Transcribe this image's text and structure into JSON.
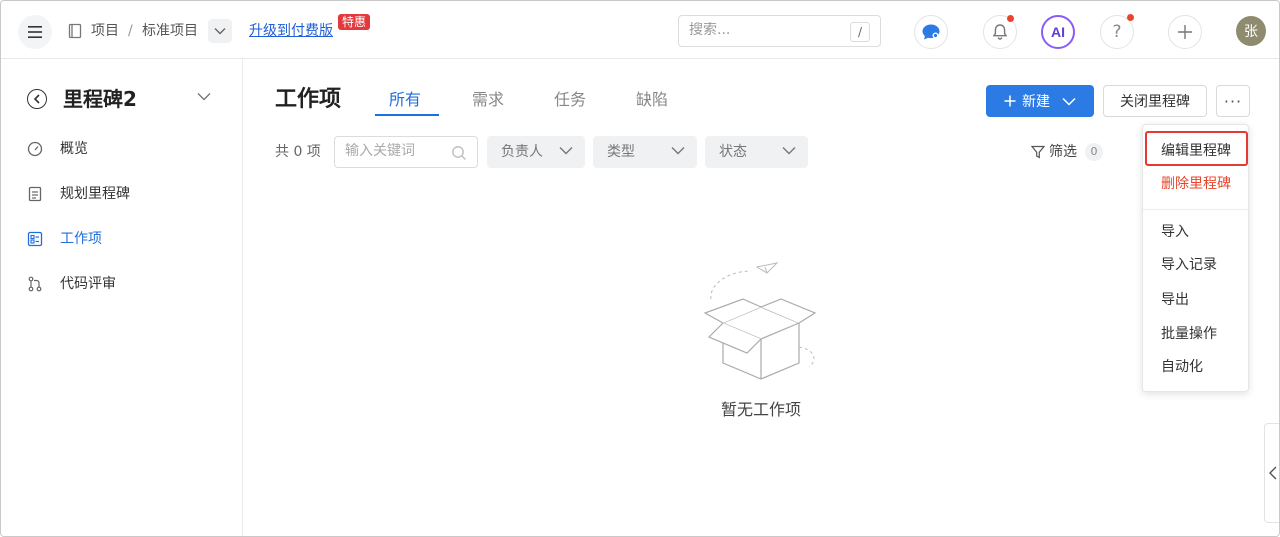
{
  "header": {
    "breadcrumb_project": "项目",
    "breadcrumb_sep": "/",
    "breadcrumb_std": "标准项目",
    "upgrade_link": "升级到付费版",
    "hot_badge": "特惠",
    "search_placeholder": "搜索...",
    "search_shortcut": "/",
    "ai_label": "AI",
    "avatar_text": "张"
  },
  "sidebar": {
    "milestone_title": "里程碑2",
    "items": [
      {
        "label": "概览",
        "icon": "gauge-icon"
      },
      {
        "label": "规划里程碑",
        "icon": "clipboard-icon"
      },
      {
        "label": "工作项",
        "icon": "checklist-icon"
      },
      {
        "label": "代码评审",
        "icon": "git-merge-icon"
      }
    ],
    "active_index": 2
  },
  "main": {
    "title": "工作项",
    "tabs": [
      "所有",
      "需求",
      "任务",
      "缺陷"
    ],
    "active_tab": 0,
    "new_button": "新建",
    "close_button": "关闭里程碑",
    "more_button": "···",
    "count_text": "共 0 项",
    "keyword_placeholder": "输入关键词",
    "filters": [
      "负责人",
      "类型",
      "状态"
    ],
    "filter_label": "筛选",
    "filter_count": "0",
    "empty_text": "暂无工作项"
  },
  "dropdown": {
    "items": [
      "编辑里程碑",
      "删除里程碑",
      "导入",
      "导入记录",
      "导出",
      "批量操作",
      "自动化"
    ]
  },
  "colors": {
    "primary": "#2c7be5",
    "active_text": "#1f6fde",
    "danger": "#e8452c",
    "highlight_border": "#e53935"
  }
}
